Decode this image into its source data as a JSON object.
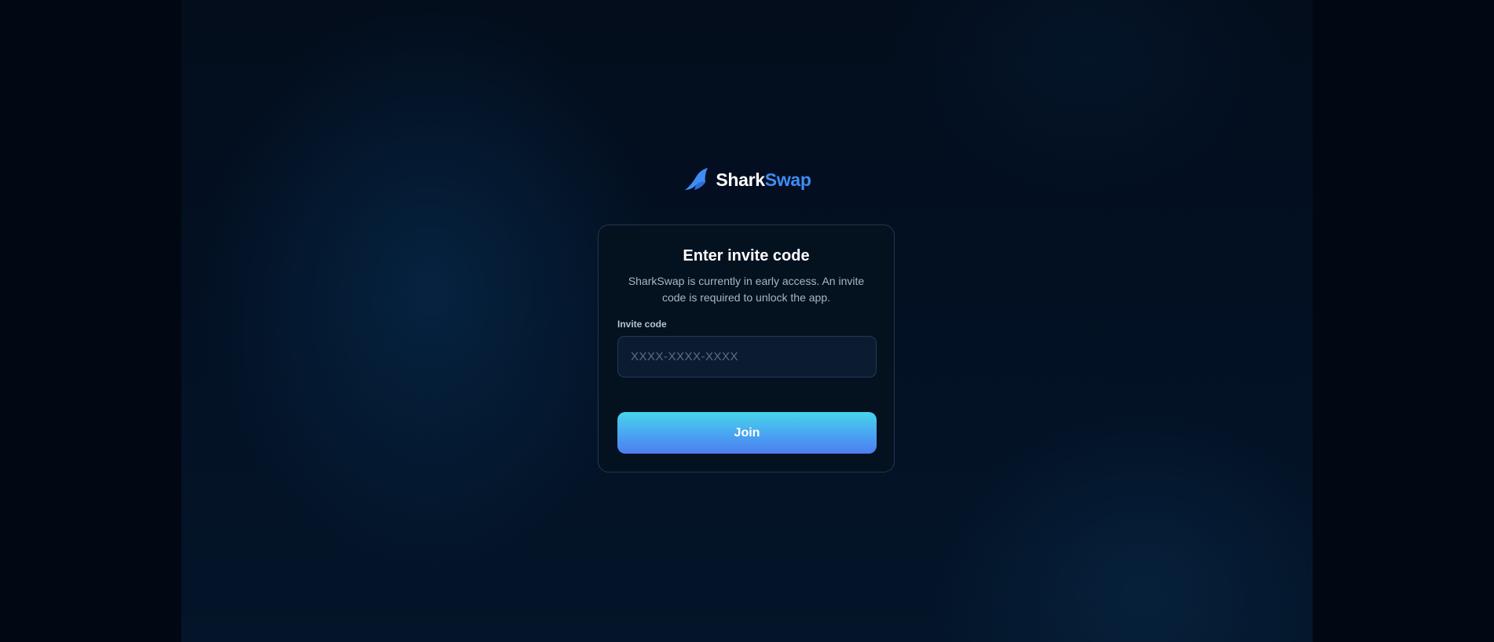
{
  "brand": {
    "name_primary": "Shark",
    "name_accent": "Swap",
    "logo_icon": "shark-fin-icon",
    "accent_color": "#3f8cf5"
  },
  "card": {
    "title": "Enter invite code",
    "subtitle": "SharkSwap is currently in early access. An invite code is required to unlock the app.",
    "invite_field": {
      "label": "Invite code",
      "value": "",
      "placeholder": "XXXX-XXXX-XXXX"
    },
    "join_button_label": "Join"
  },
  "colors": {
    "background": "#020916",
    "card_background": "#04111f",
    "button_gradient_top": "#47d5ea",
    "button_gradient_bottom": "#4c7fee"
  }
}
